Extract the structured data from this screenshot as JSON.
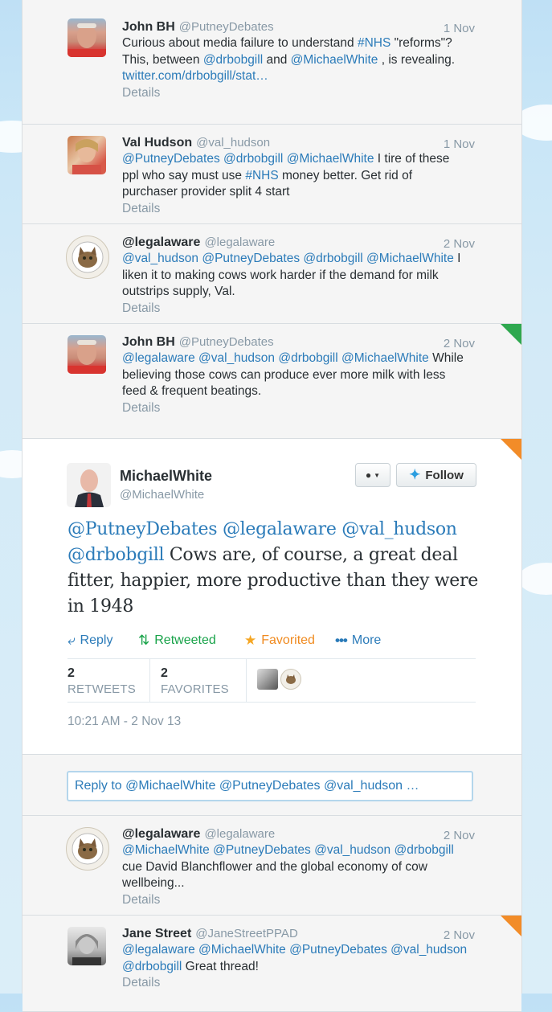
{
  "colors": {
    "link": "#2b7bb9",
    "favorited": "#f59e0b",
    "retweeted": "#19a34a",
    "corner_green": "#2fa84f",
    "corner_orange": "#f28c28"
  },
  "tweets_above": [
    {
      "name": "John BH",
      "handle": "@PutneyDebates",
      "date": "1 Nov",
      "text_parts": [
        {
          "t": "Curious about media failure to understand ",
          "link": false
        },
        {
          "t": "#NHS",
          "link": true
        },
        {
          "t": " \"reforms\"? This, between ",
          "link": false
        },
        {
          "t": "@drbobgill",
          "link": true
        },
        {
          "t": " and ",
          "link": false
        },
        {
          "t": "@MichaelWhite",
          "link": true
        },
        {
          "t": " , is revealing. ",
          "link": false
        },
        {
          "t": "twitter.com/drbobgill/stat…",
          "link": true
        }
      ],
      "details": "Details"
    },
    {
      "name": "Val Hudson",
      "handle": "@val_hudson",
      "date": "1 Nov",
      "text_parts": [
        {
          "t": "@PutneyDebates",
          "link": true
        },
        {
          "t": " ",
          "link": false
        },
        {
          "t": "@drbobgill",
          "link": true
        },
        {
          "t": " ",
          "link": false
        },
        {
          "t": "@MichaelWhite",
          "link": true
        },
        {
          "t": " I tire of these ppl who say must use ",
          "link": false
        },
        {
          "t": "#NHS",
          "link": true
        },
        {
          "t": " money better. Get rid of purchaser provider split 4 start",
          "link": false
        }
      ],
      "details": "Details"
    },
    {
      "name": "@legalaware",
      "handle": "@legalaware",
      "date": "2 Nov",
      "text_parts": [
        {
          "t": "@val_hudson",
          "link": true
        },
        {
          "t": " ",
          "link": false
        },
        {
          "t": "@PutneyDebates",
          "link": true
        },
        {
          "t": " ",
          "link": false
        },
        {
          "t": "@drbobgill",
          "link": true
        },
        {
          "t": " ",
          "link": false
        },
        {
          "t": "@MichaelWhite",
          "link": true
        },
        {
          "t": " I liken it to making cows work harder if the demand for milk outstrips supply, Val.",
          "link": false
        }
      ],
      "details": "Details"
    },
    {
      "name": "John BH",
      "handle": "@PutneyDebates",
      "date": "2 Nov",
      "text_parts": [
        {
          "t": "@legalaware",
          "link": true
        },
        {
          "t": " ",
          "link": false
        },
        {
          "t": "@val_hudson",
          "link": true
        },
        {
          "t": " ",
          "link": false
        },
        {
          "t": "@drbobgill",
          "link": true
        },
        {
          "t": " ",
          "link": false
        },
        {
          "t": "@MichaelWhite",
          "link": true
        },
        {
          "t": " While believing those cows can produce ever more milk with less feed & frequent beatings.",
          "link": false
        }
      ],
      "details": "Details"
    }
  ],
  "main_tweet": {
    "name": "MichaelWhite",
    "handle": "@MichaelWhite",
    "follow_label": "Follow",
    "text_parts": [
      {
        "t": "@PutneyDebates",
        "link": true
      },
      {
        "t": " ",
        "link": false
      },
      {
        "t": "@legalaware",
        "link": true
      },
      {
        "t": " ",
        "link": false
      },
      {
        "t": "@val_hudson",
        "link": true
      },
      {
        "t": " ",
        "link": false
      },
      {
        "t": "@drbobgill",
        "link": true
      },
      {
        "t": " Cows are, of course, a great deal fitter, happier, more productive than they were in 1948",
        "link": false
      }
    ],
    "actions": {
      "reply": "Reply",
      "retweeted": "Retweeted",
      "favorited": "Favorited",
      "more": "More"
    },
    "retweets_count": "2",
    "retweets_label": "RETWEETS",
    "favorites_count": "2",
    "favorites_label": "FAVORITES",
    "timestamp": "10:21 AM - 2 Nov 13"
  },
  "reply_box_text": "Reply to @MichaelWhite @PutneyDebates @val_hudson …",
  "tweets_below": [
    {
      "name": "@legalaware",
      "handle": "@legalaware",
      "date": "2 Nov",
      "text_parts": [
        {
          "t": "@MichaelWhite",
          "link": true
        },
        {
          "t": " ",
          "link": false
        },
        {
          "t": "@PutneyDebates",
          "link": true
        },
        {
          "t": " ",
          "link": false
        },
        {
          "t": "@val_hudson",
          "link": true
        },
        {
          "t": " ",
          "link": false
        },
        {
          "t": "@drbobgill",
          "link": true
        },
        {
          "t": " cue David Blanchflower and the global economy of cow wellbeing...",
          "link": false
        }
      ],
      "details": "Details"
    },
    {
      "name": "Jane Street",
      "handle": "@JaneStreetPPAD",
      "date": "2 Nov",
      "text_parts": [
        {
          "t": "@legalaware",
          "link": true
        },
        {
          "t": " ",
          "link": false
        },
        {
          "t": "@MichaelWhite",
          "link": true
        },
        {
          "t": " ",
          "link": false
        },
        {
          "t": "@PutneyDebates",
          "link": true
        },
        {
          "t": " ",
          "link": false
        },
        {
          "t": "@val_hudson",
          "link": true
        },
        {
          "t": " ",
          "link": false
        },
        {
          "t": "@drbobgill",
          "link": true
        },
        {
          "t": " Great thread!",
          "link": false
        }
      ],
      "details": "Details"
    }
  ]
}
